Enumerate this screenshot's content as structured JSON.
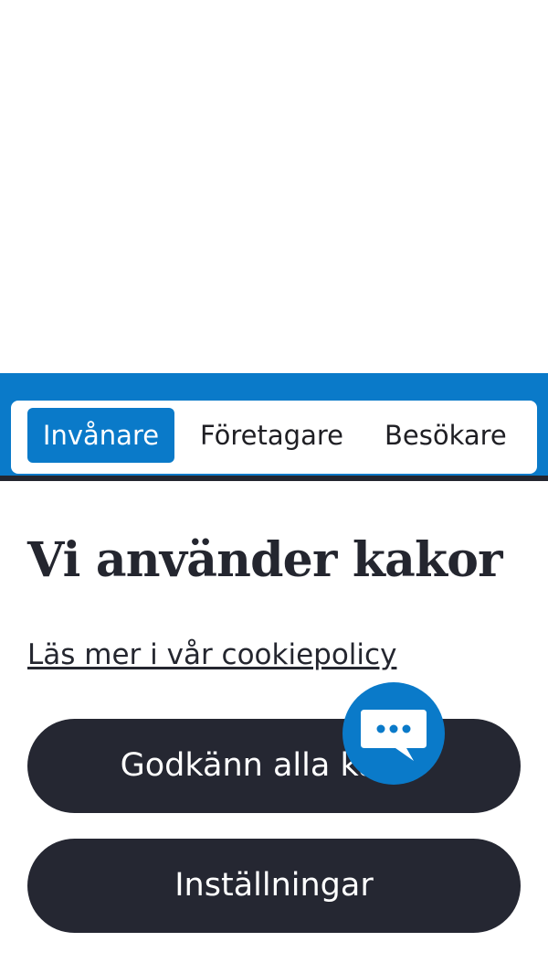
{
  "audience_nav": {
    "tabs": [
      {
        "label": "Invånare",
        "active": true
      },
      {
        "label": "Företagare",
        "active": false
      },
      {
        "label": "Besökare",
        "active": false
      }
    ]
  },
  "cookie_banner": {
    "title": "Vi använder kakor",
    "policy_link": "Läs mer i vår cookiepolicy",
    "accept_label": "Godkänn alla kakor",
    "settings_label": "Inställningar"
  },
  "chat_widget": {
    "icon": "chat-bubble-icon"
  },
  "colors": {
    "primary_blue": "#0a7ac9",
    "dark_navy": "#252732",
    "white": "#ffffff"
  }
}
